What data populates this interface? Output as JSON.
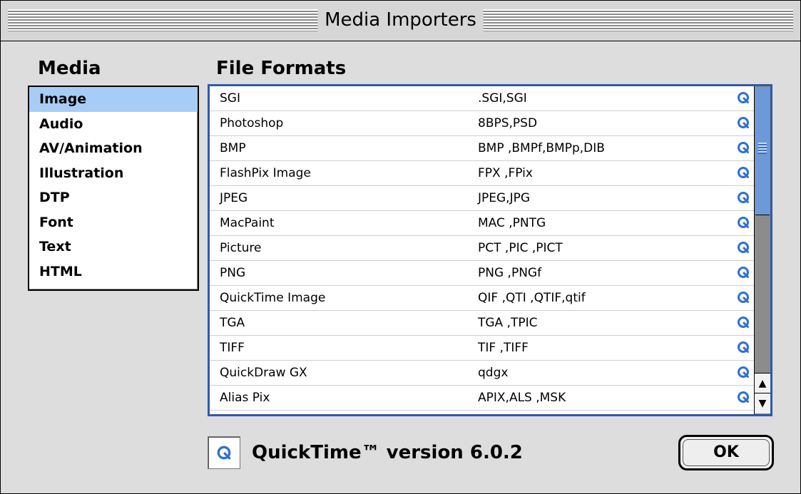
{
  "window": {
    "title": "Media Importers"
  },
  "media": {
    "heading": "Media",
    "items": [
      "Image",
      "Audio",
      "AV/Animation",
      "Illustration",
      "DTP",
      "Font",
      "Text",
      "HTML"
    ],
    "selected_index": 0
  },
  "formats": {
    "heading": "File Formats",
    "rows": [
      {
        "name": "SGI",
        "ext": ".SGI,SGI"
      },
      {
        "name": "Photoshop",
        "ext": "8BPS,PSD"
      },
      {
        "name": "BMP",
        "ext": "BMP ,BMPf,BMPp,DIB"
      },
      {
        "name": "FlashPix Image",
        "ext": "FPX ,FPix"
      },
      {
        "name": "JPEG",
        "ext": "JPEG,JPG"
      },
      {
        "name": "MacPaint",
        "ext": "MAC ,PNTG"
      },
      {
        "name": "Picture",
        "ext": "PCT ,PIC ,PICT"
      },
      {
        "name": "PNG",
        "ext": "PNG ,PNGf"
      },
      {
        "name": "QuickTime Image",
        "ext": "QIF ,QTI ,QTIF,qtif"
      },
      {
        "name": "TGA",
        "ext": "TGA ,TPIC"
      },
      {
        "name": "TIFF",
        "ext": "TIF ,TIFF"
      },
      {
        "name": "QuickDraw GX",
        "ext": "qdgx"
      },
      {
        "name": "Alias Pix",
        "ext": "APIX,ALS ,MSK"
      }
    ],
    "row_icon": "quicktime-icon",
    "scroll_position": 0.0
  },
  "footer": {
    "version_text": "QuickTime™ version 6.0.2",
    "ok_label": "OK"
  },
  "colors": {
    "selection": "#a7cdf6",
    "accent": "#305aa8",
    "thumb": "#6e99d9"
  }
}
